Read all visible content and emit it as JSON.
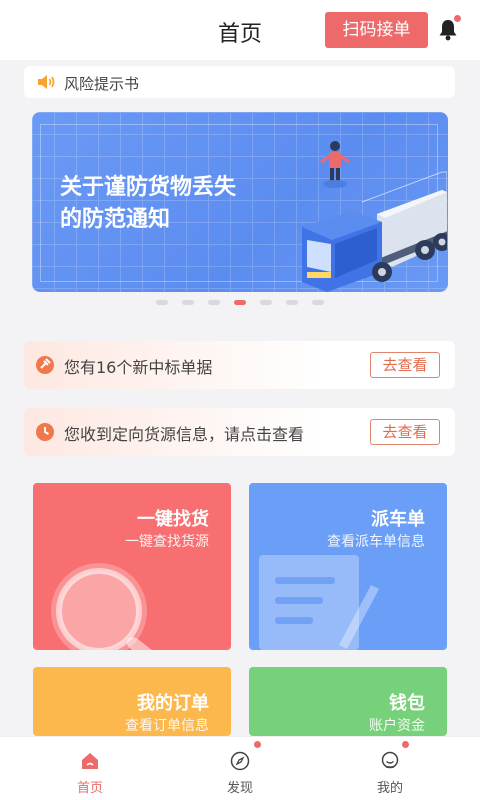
{
  "header": {
    "title": "首页",
    "scan_button": "扫码接单"
  },
  "notice": {
    "text": "风险提示书"
  },
  "banner": {
    "line1": "关于谨防货物丢失",
    "line2": "的防范通知",
    "slides": 7,
    "active_slide": 4
  },
  "alerts": [
    {
      "text": "您有16个新中标单据",
      "action": "去查看",
      "icon": "auction-icon"
    },
    {
      "text": "您收到定向货源信息，请点击查看",
      "action": "去查看",
      "icon": "clock-icon"
    }
  ],
  "cards": [
    {
      "title": "一键找货",
      "subtitle": "一键查找货源",
      "color": "#f76f70",
      "icon": "magnifier-icon"
    },
    {
      "title": "派车单",
      "subtitle": "查看派车单信息",
      "color": "#6a9ef7",
      "icon": "document-pen-icon"
    },
    {
      "title": "我的订单",
      "subtitle": "查看订单信息",
      "color": "#fdb84d",
      "icon": "order-icon"
    },
    {
      "title": "钱包",
      "subtitle": "账户资金",
      "color": "#77d07a",
      "icon": "wallet-icon"
    }
  ],
  "tabbar": [
    {
      "label": "首页",
      "icon": "home-icon",
      "active": true
    },
    {
      "label": "发现",
      "icon": "compass-icon",
      "badge": true
    },
    {
      "label": "我的",
      "icon": "profile-icon",
      "badge": true
    }
  ],
  "colors": {
    "accent": "#ee6a6a",
    "banner": "#5b8cf0",
    "alert_orange": "#f0784c"
  }
}
